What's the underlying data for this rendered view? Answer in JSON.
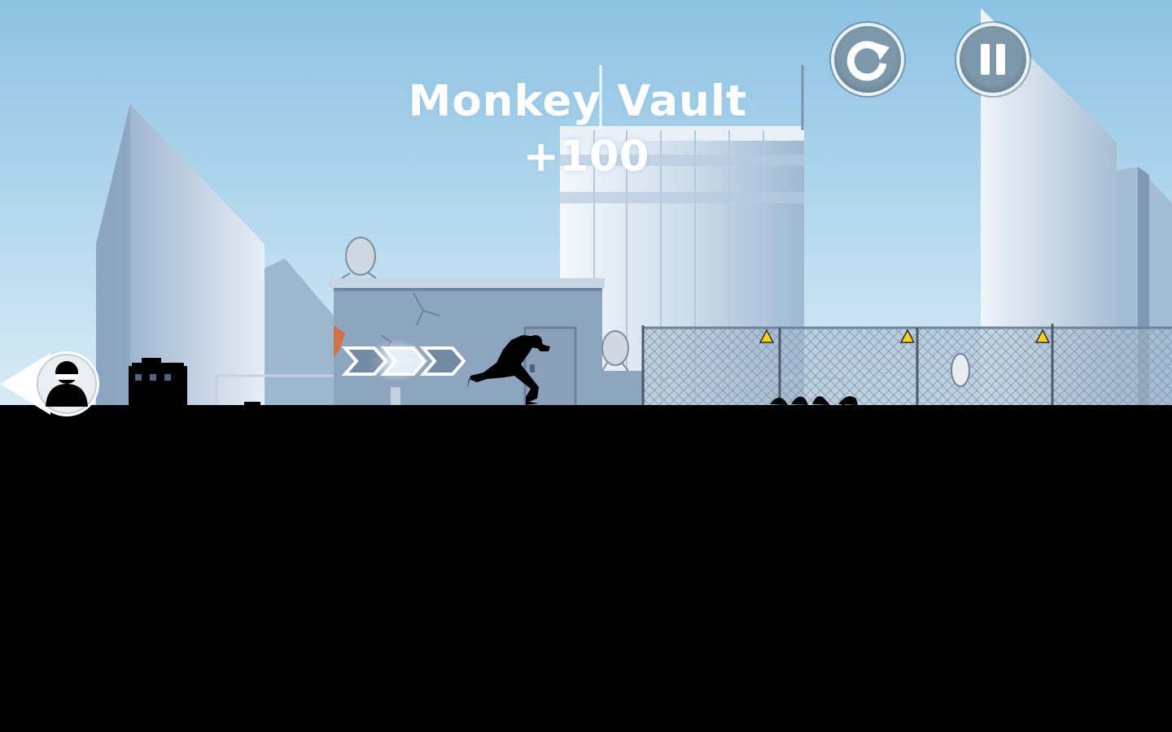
{
  "trick": {
    "name": "Monkey Vault",
    "points": "+100"
  },
  "controls": {
    "restart_icon": "restart-icon",
    "pause_icon": "pause-icon"
  },
  "hud": {
    "hunter_indicator_icon": "hunter-head-icon"
  },
  "colors": {
    "sky_top": "#8fc3e2",
    "sky_bottom": "#d9ecf6",
    "ground": "#000000",
    "button_fill": "#7d98aa",
    "button_border": "#e9f1f6",
    "hazard_sign": "#f2d21c"
  }
}
